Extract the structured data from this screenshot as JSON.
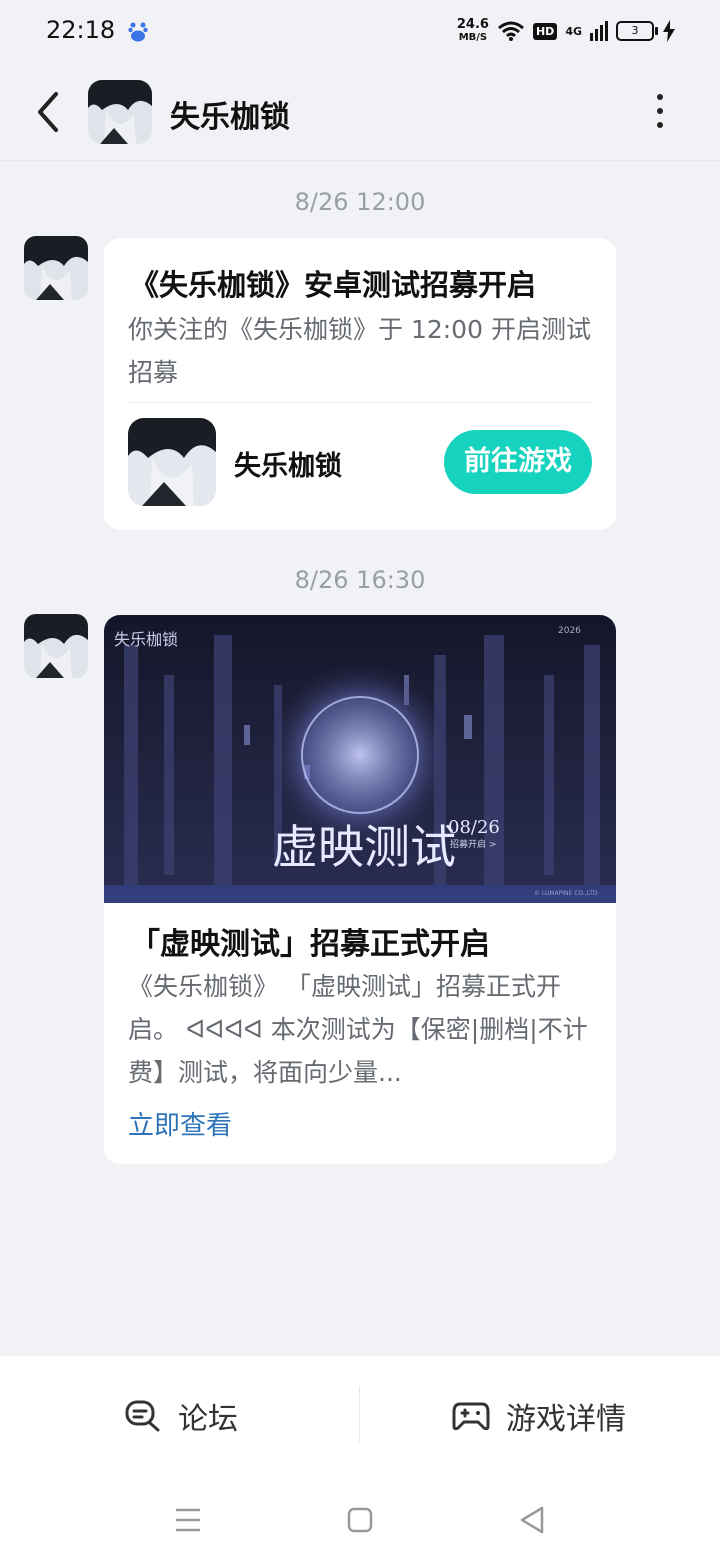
{
  "status_bar": {
    "time": "22:18",
    "speed_value": "24.6",
    "speed_unit": "MB/S",
    "hd": "HD",
    "network": "4G",
    "battery": "3"
  },
  "header": {
    "title": "失乐枷锁"
  },
  "messages": [
    {
      "timestamp": "8/26  12:00",
      "title": "《失乐枷锁》安卓测试招募开启",
      "body": "你关注的《失乐枷锁》于 12:00 开启测试招募",
      "game_name": "失乐枷锁",
      "button": "前往游戏"
    },
    {
      "timestamp": "8/26  16:30",
      "banner": {
        "logo": "失乐枷锁",
        "year": "2026",
        "main": "虚映测试",
        "date": "08/26",
        "sub": "招募开启 >",
        "copyright": "© LUMAPINE CO.,LTD"
      },
      "title": "「虚映测试」招募正式开启",
      "body": "《失乐枷锁》 「虚映测试」招募正式开启。 ᐊᐊᐊᐊ 本次测试为【保密|删档|不计费】测试，将面向少量...",
      "link": "立即查看"
    }
  ],
  "bottom_bar": {
    "forum": "论坛",
    "game_detail": "游戏详情"
  },
  "colors": {
    "accent": "#15d3be",
    "link": "#2d74b8",
    "background": "#f1f2f5"
  }
}
